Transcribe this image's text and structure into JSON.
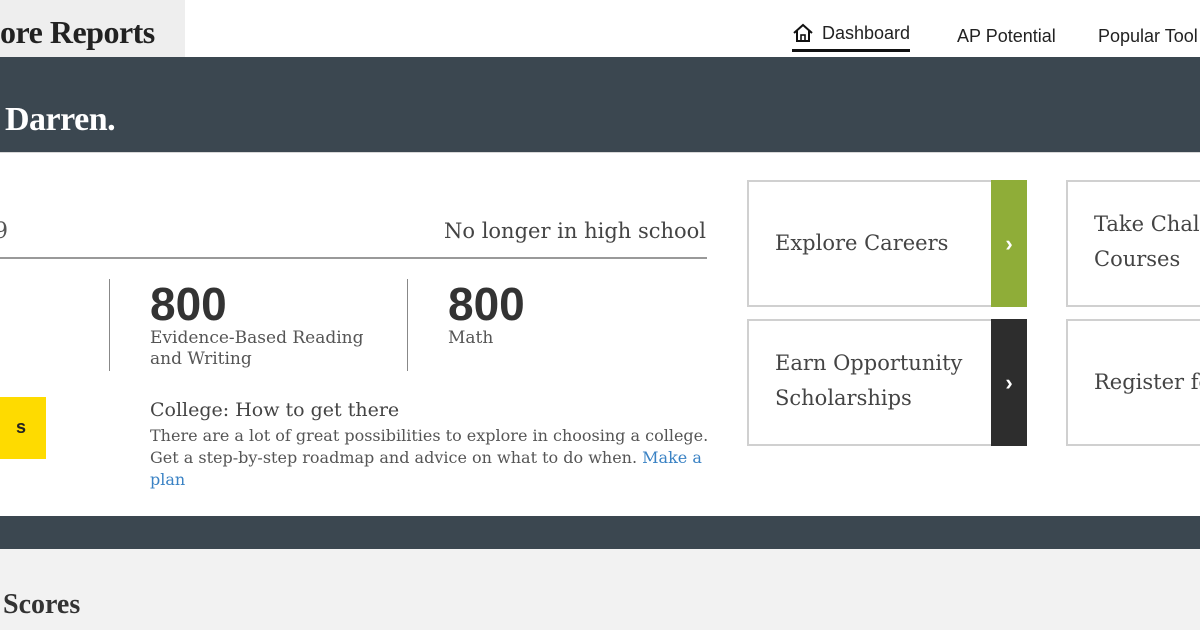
{
  "header": {
    "title": "ore Reports",
    "nav": [
      {
        "label": "Dashboard",
        "icon": "home-icon",
        "active": true
      },
      {
        "label": "AP Potential"
      },
      {
        "label": "Popular Tool"
      }
    ]
  },
  "banner": {
    "greeting": "Darren."
  },
  "profile": {
    "date_fragment": "9",
    "status": "No longer in high school"
  },
  "scores": [
    {
      "value": "800",
      "label": "Evidence-Based Reading and Writing"
    },
    {
      "value": "800",
      "label": "Math"
    }
  ],
  "cta": {
    "label": "s",
    "color": "#fedb00"
  },
  "plan": {
    "title": "College: How to get there",
    "text": "There are a lot of great possibilities to explore in choosing a college. Get a step-by-step roadmap and advice on what to do when.",
    "link_label": "Make a plan"
  },
  "tiles": [
    {
      "label": "Explore Careers",
      "accent": "#8fad38"
    },
    {
      "label": "Earn Opportunity Scholarships",
      "accent": "#2d2d2d"
    },
    {
      "label": "Take Chal Courses"
    },
    {
      "label": "Register fo"
    }
  ],
  "section": {
    "title": "Scores"
  },
  "colors": {
    "banner": "#3b4750",
    "link": "#3a82c4"
  }
}
